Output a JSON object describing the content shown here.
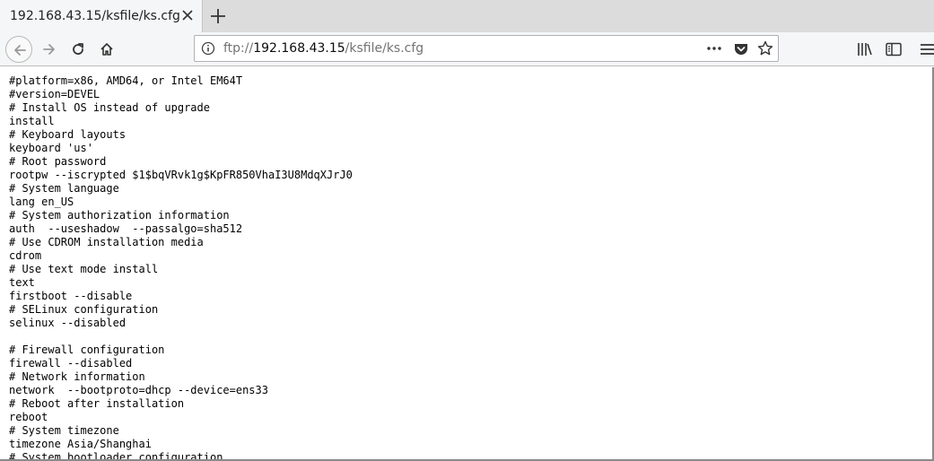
{
  "tab": {
    "title": "192.168.43.15/ksfile/ks.cfg"
  },
  "urlbar": {
    "scheme": "ftp://",
    "host": "192.168.43.15",
    "path": "/ksfile/ks.cfg"
  },
  "file": {
    "lines": [
      "#platform=x86, AMD64, or Intel EM64T",
      "#version=DEVEL",
      "# Install OS instead of upgrade",
      "install",
      "# Keyboard layouts",
      "keyboard 'us'",
      "# Root password",
      "rootpw --iscrypted $1$bqVRvk1g$KpFR850VhaI3U8MdqXJrJ0",
      "# System language",
      "lang en_US",
      "# System authorization information",
      "auth  --useshadow  --passalgo=sha512",
      "# Use CDROM installation media",
      "cdrom",
      "# Use text mode install",
      "text",
      "firstboot --disable",
      "# SELinux configuration",
      "selinux --disabled",
      "",
      "# Firewall configuration",
      "firewall --disabled",
      "# Network information",
      "network  --bootproto=dhcp --device=ens33",
      "# Reboot after installation",
      "reboot",
      "# System timezone",
      "timezone Asia/Shanghai",
      "# System bootloader configuration"
    ]
  },
  "icons": {
    "tab_close": "close-icon",
    "new_tab": "plus-icon",
    "back": "arrow-left-icon",
    "forward": "arrow-right-icon",
    "reload": "reload-icon",
    "home": "home-icon",
    "info": "info-icon",
    "page_actions": "more-icon",
    "pocket": "pocket-icon",
    "bookmark": "star-icon",
    "library": "library-icon",
    "sidebar": "sidebar-icon",
    "menu": "hamburger-menu-icon"
  },
  "colors": {
    "chrome": "#f5f6f7",
    "tabstrip": "#dcdcdc",
    "text": "#000000"
  }
}
